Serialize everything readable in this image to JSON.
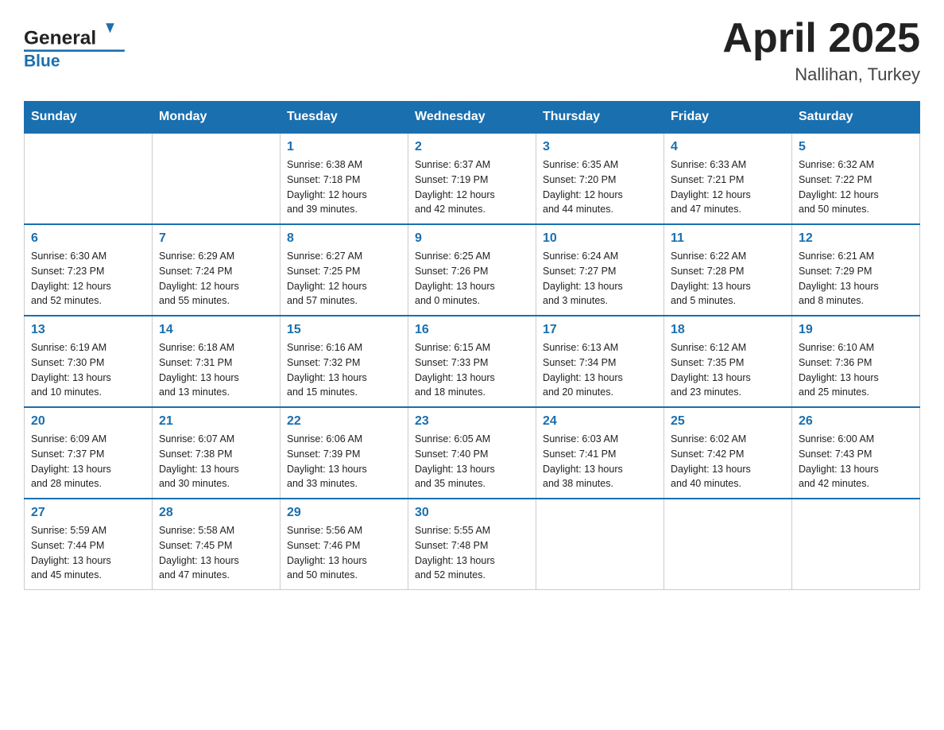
{
  "header": {
    "logo_general": "General",
    "logo_blue": "Blue",
    "title": "April 2025",
    "subtitle": "Nallihan, Turkey"
  },
  "weekdays": [
    "Sunday",
    "Monday",
    "Tuesday",
    "Wednesday",
    "Thursday",
    "Friday",
    "Saturday"
  ],
  "weeks": [
    [
      {
        "day": "",
        "info": ""
      },
      {
        "day": "",
        "info": ""
      },
      {
        "day": "1",
        "info": "Sunrise: 6:38 AM\nSunset: 7:18 PM\nDaylight: 12 hours\nand 39 minutes."
      },
      {
        "day": "2",
        "info": "Sunrise: 6:37 AM\nSunset: 7:19 PM\nDaylight: 12 hours\nand 42 minutes."
      },
      {
        "day": "3",
        "info": "Sunrise: 6:35 AM\nSunset: 7:20 PM\nDaylight: 12 hours\nand 44 minutes."
      },
      {
        "day": "4",
        "info": "Sunrise: 6:33 AM\nSunset: 7:21 PM\nDaylight: 12 hours\nand 47 minutes."
      },
      {
        "day": "5",
        "info": "Sunrise: 6:32 AM\nSunset: 7:22 PM\nDaylight: 12 hours\nand 50 minutes."
      }
    ],
    [
      {
        "day": "6",
        "info": "Sunrise: 6:30 AM\nSunset: 7:23 PM\nDaylight: 12 hours\nand 52 minutes."
      },
      {
        "day": "7",
        "info": "Sunrise: 6:29 AM\nSunset: 7:24 PM\nDaylight: 12 hours\nand 55 minutes."
      },
      {
        "day": "8",
        "info": "Sunrise: 6:27 AM\nSunset: 7:25 PM\nDaylight: 12 hours\nand 57 minutes."
      },
      {
        "day": "9",
        "info": "Sunrise: 6:25 AM\nSunset: 7:26 PM\nDaylight: 13 hours\nand 0 minutes."
      },
      {
        "day": "10",
        "info": "Sunrise: 6:24 AM\nSunset: 7:27 PM\nDaylight: 13 hours\nand 3 minutes."
      },
      {
        "day": "11",
        "info": "Sunrise: 6:22 AM\nSunset: 7:28 PM\nDaylight: 13 hours\nand 5 minutes."
      },
      {
        "day": "12",
        "info": "Sunrise: 6:21 AM\nSunset: 7:29 PM\nDaylight: 13 hours\nand 8 minutes."
      }
    ],
    [
      {
        "day": "13",
        "info": "Sunrise: 6:19 AM\nSunset: 7:30 PM\nDaylight: 13 hours\nand 10 minutes."
      },
      {
        "day": "14",
        "info": "Sunrise: 6:18 AM\nSunset: 7:31 PM\nDaylight: 13 hours\nand 13 minutes."
      },
      {
        "day": "15",
        "info": "Sunrise: 6:16 AM\nSunset: 7:32 PM\nDaylight: 13 hours\nand 15 minutes."
      },
      {
        "day": "16",
        "info": "Sunrise: 6:15 AM\nSunset: 7:33 PM\nDaylight: 13 hours\nand 18 minutes."
      },
      {
        "day": "17",
        "info": "Sunrise: 6:13 AM\nSunset: 7:34 PM\nDaylight: 13 hours\nand 20 minutes."
      },
      {
        "day": "18",
        "info": "Sunrise: 6:12 AM\nSunset: 7:35 PM\nDaylight: 13 hours\nand 23 minutes."
      },
      {
        "day": "19",
        "info": "Sunrise: 6:10 AM\nSunset: 7:36 PM\nDaylight: 13 hours\nand 25 minutes."
      }
    ],
    [
      {
        "day": "20",
        "info": "Sunrise: 6:09 AM\nSunset: 7:37 PM\nDaylight: 13 hours\nand 28 minutes."
      },
      {
        "day": "21",
        "info": "Sunrise: 6:07 AM\nSunset: 7:38 PM\nDaylight: 13 hours\nand 30 minutes."
      },
      {
        "day": "22",
        "info": "Sunrise: 6:06 AM\nSunset: 7:39 PM\nDaylight: 13 hours\nand 33 minutes."
      },
      {
        "day": "23",
        "info": "Sunrise: 6:05 AM\nSunset: 7:40 PM\nDaylight: 13 hours\nand 35 minutes."
      },
      {
        "day": "24",
        "info": "Sunrise: 6:03 AM\nSunset: 7:41 PM\nDaylight: 13 hours\nand 38 minutes."
      },
      {
        "day": "25",
        "info": "Sunrise: 6:02 AM\nSunset: 7:42 PM\nDaylight: 13 hours\nand 40 minutes."
      },
      {
        "day": "26",
        "info": "Sunrise: 6:00 AM\nSunset: 7:43 PM\nDaylight: 13 hours\nand 42 minutes."
      }
    ],
    [
      {
        "day": "27",
        "info": "Sunrise: 5:59 AM\nSunset: 7:44 PM\nDaylight: 13 hours\nand 45 minutes."
      },
      {
        "day": "28",
        "info": "Sunrise: 5:58 AM\nSunset: 7:45 PM\nDaylight: 13 hours\nand 47 minutes."
      },
      {
        "day": "29",
        "info": "Sunrise: 5:56 AM\nSunset: 7:46 PM\nDaylight: 13 hours\nand 50 minutes."
      },
      {
        "day": "30",
        "info": "Sunrise: 5:55 AM\nSunset: 7:48 PM\nDaylight: 13 hours\nand 52 minutes."
      },
      {
        "day": "",
        "info": ""
      },
      {
        "day": "",
        "info": ""
      },
      {
        "day": "",
        "info": ""
      }
    ]
  ]
}
